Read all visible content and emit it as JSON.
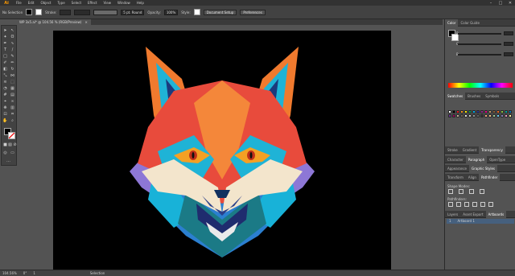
{
  "app": {
    "logo": "Ai"
  },
  "menu": [
    "File",
    "Edit",
    "Object",
    "Type",
    "Select",
    "Effect",
    "View",
    "Window",
    "Help"
  ],
  "control": {
    "selection_label": "No Selection",
    "stroke_label": "Stroke:",
    "brush": "5 pt. Round",
    "opacity_label": "Opacity:",
    "opacity_value": "100%",
    "style_label": "Style:",
    "doc_setup": "Document Setup",
    "preferences": "Preferences"
  },
  "tab": {
    "title": "WP 3x5.ai* @ 104.56 % (RGB/Preview)",
    "close": "×"
  },
  "status": {
    "zoom": "104.56%",
    "rotation": "0°",
    "artboard": "1",
    "tool": "Selection"
  },
  "panels": {
    "color_tabs": [
      "Color",
      "Color Guide"
    ],
    "color_channels": [
      "R",
      "G",
      "B"
    ],
    "swatch_tabs": [
      "Swatches",
      "Brushes",
      "Symbols"
    ],
    "stroke_tabs": [
      "Stroke",
      "Gradient",
      "Transparency"
    ],
    "char_tabs": [
      "Character",
      "Paragraph",
      "OpenType"
    ],
    "app_tabs": [
      "Appearance",
      "Graphic Styles"
    ],
    "tr_tabs": [
      "Transform",
      "Align",
      "Pathfinder"
    ],
    "shape_modes": "Shape Modes:",
    "pathfinders": "Pathfinders:",
    "layer_tabs": [
      "Layers",
      "Asset Export",
      "Artboards"
    ],
    "artboard_row_num": "1",
    "artboard_row_name": "Artboard 1"
  },
  "colors": {
    "accent": "#4a90e2",
    "canvas": "#000000",
    "swatches": [
      "#ffffff",
      "#000000",
      "#ed1c24",
      "#f7941d",
      "#fff200",
      "#00a651",
      "#00aeef",
      "#2e3192",
      "#92278f",
      "#ec008c",
      "#c69c6d",
      "#8c6239",
      "#f26522",
      "#8dc63f",
      "#00a99d",
      "#0072bc",
      "#662d91",
      "#9e005d",
      "#c7b299",
      "#736357",
      "#e6e6e6",
      "#cccccc",
      "#999999",
      "#666666",
      "#333333",
      "#f9ad81",
      "#fdc689",
      "#a3d39c",
      "#6dcff6",
      "#8781bd",
      "#f49ac1",
      "#fff799"
    ]
  }
}
